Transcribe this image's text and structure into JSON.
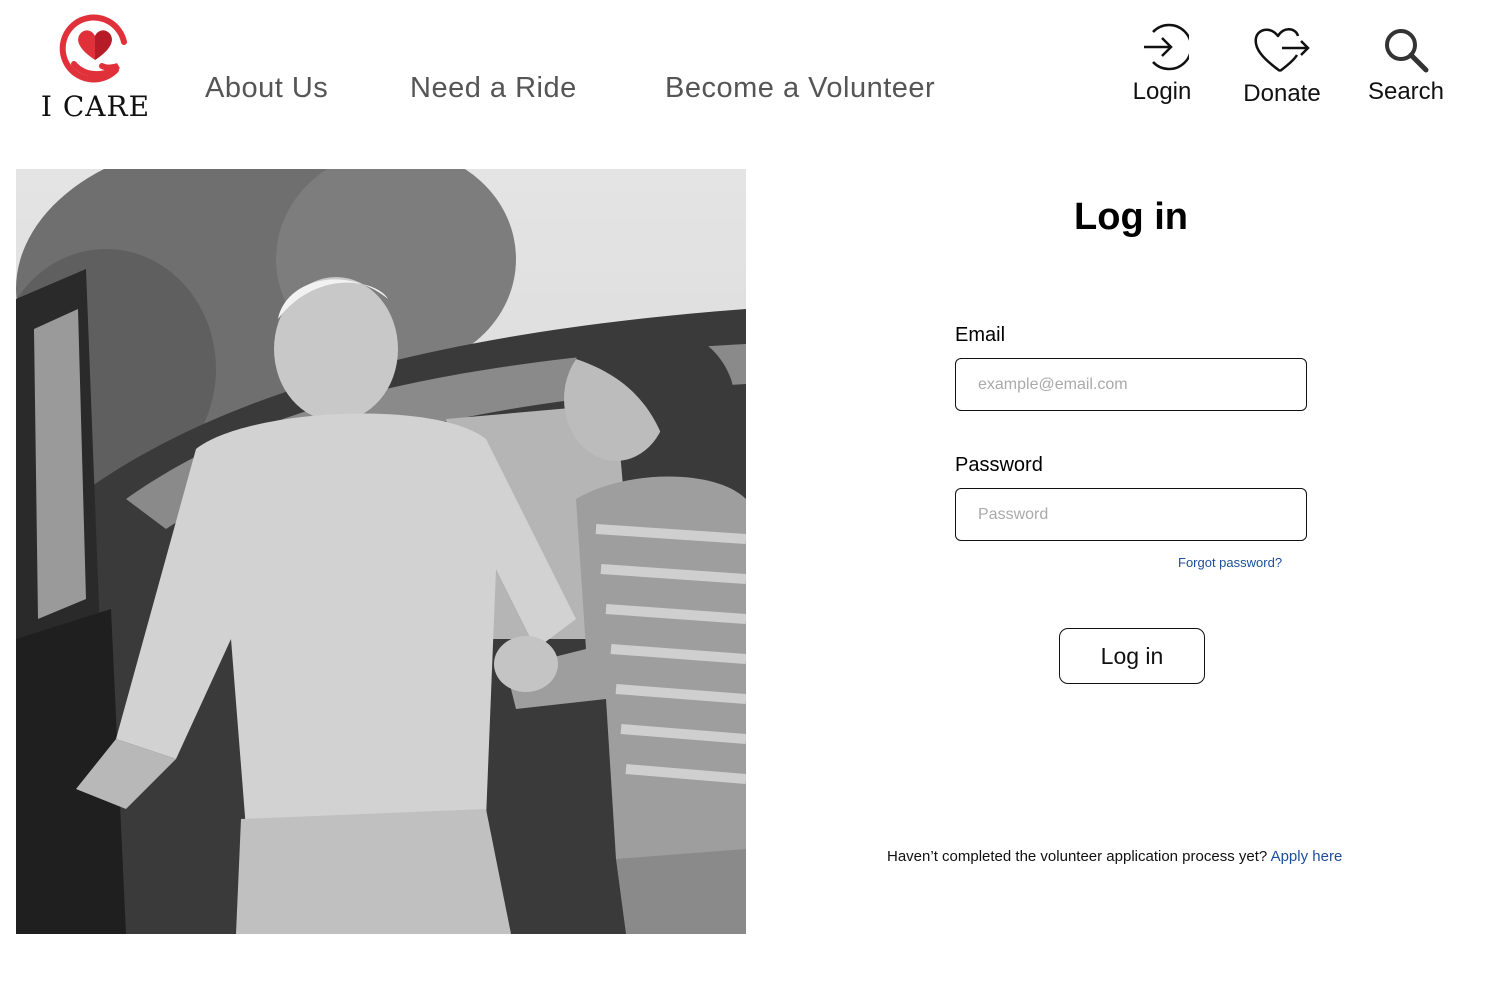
{
  "brand": {
    "name": "I CARE",
    "logo_color": "#e0313b"
  },
  "nav": {
    "about": "About Us",
    "ride": "Need a Ride",
    "volunteer": "Become a Volunteer"
  },
  "utility": {
    "login": {
      "label": "Login",
      "icon": "login-arrow-icon"
    },
    "donate": {
      "label": "Donate",
      "icon": "heart-arrow-icon"
    },
    "search": {
      "label": "Search",
      "icon": "magnifier-icon"
    }
  },
  "hero": {
    "description": "grayscale photo of a woman helping an older man out of a car"
  },
  "login_form": {
    "title": "Log in",
    "email_label": "Email",
    "email_placeholder": "example@email.com",
    "password_label": "Password",
    "password_placeholder": "Password",
    "forgot": "Forgot password?",
    "submit": "Log in"
  },
  "footer_prompt": {
    "text": "Haven’t completed the volunteer application process yet?",
    "link": "Apply here"
  },
  "colors": {
    "link": "#1c4e9c",
    "accent": "#e0313b"
  }
}
